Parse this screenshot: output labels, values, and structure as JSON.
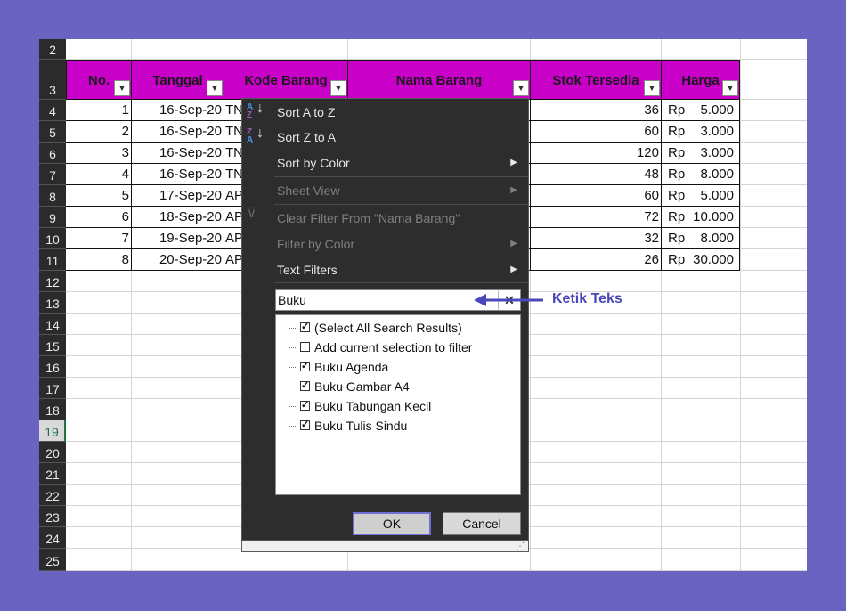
{
  "rows": [
    "2",
    "3",
    "4",
    "5",
    "6",
    "7",
    "8",
    "9",
    "10",
    "11",
    "12",
    "13",
    "14",
    "15",
    "16",
    "17",
    "18",
    "19",
    "20",
    "21",
    "22",
    "23",
    "24",
    "25"
  ],
  "headers": {
    "no": "No.",
    "tanggal": "Tanggal",
    "kode": "Kode Barang",
    "nama": "Nama Barang",
    "stok": "Stok Tersedia",
    "harga": "Harga"
  },
  "data": [
    {
      "no": "1",
      "tanggal": "16-Sep-20",
      "kode": "TN",
      "stok": "36",
      "rp": "Rp",
      "harga": "5.000"
    },
    {
      "no": "2",
      "tanggal": "16-Sep-20",
      "kode": "TN",
      "stok": "60",
      "rp": "Rp",
      "harga": "3.000"
    },
    {
      "no": "3",
      "tanggal": "16-Sep-20",
      "kode": "TN",
      "stok": "120",
      "rp": "Rp",
      "harga": "3.000"
    },
    {
      "no": "4",
      "tanggal": "16-Sep-20",
      "kode": "TN",
      "stok": "48",
      "rp": "Rp",
      "harga": "8.000"
    },
    {
      "no": "5",
      "tanggal": "17-Sep-20",
      "kode": "AP",
      "stok": "60",
      "rp": "Rp",
      "harga": "5.000"
    },
    {
      "no": "6",
      "tanggal": "18-Sep-20",
      "kode": "AP",
      "stok": "72",
      "rp": "Rp",
      "harga": "10.000"
    },
    {
      "no": "7",
      "tanggal": "19-Sep-20",
      "kode": "AP",
      "stok": "32",
      "rp": "Rp",
      "harga": "8.000"
    },
    {
      "no": "8",
      "tanggal": "20-Sep-20",
      "kode": "AP",
      "stok": "26",
      "rp": "Rp",
      "harga": "30.000"
    }
  ],
  "menu": {
    "items": [
      {
        "label": "Sort A to Z",
        "icon": "sort-a-z-icon",
        "disabled": false,
        "arrow": false
      },
      {
        "label": "Sort Z to A",
        "icon": "sort-z-a-icon",
        "disabled": false,
        "arrow": false
      },
      {
        "label": "Sort by Color",
        "icon": "",
        "disabled": false,
        "arrow": true
      },
      {
        "label": "Sheet View",
        "icon": "",
        "disabled": true,
        "arrow": true
      },
      {
        "label": "Clear Filter From \"Nama Barang\"",
        "icon": "clear-filter-icon",
        "disabled": true,
        "arrow": false
      },
      {
        "label": "Filter by Color",
        "icon": "",
        "disabled": true,
        "arrow": true
      },
      {
        "label": "Text Filters",
        "icon": "",
        "disabled": false,
        "arrow": true
      }
    ],
    "search_value": "Buku",
    "list": [
      {
        "label": "(Select All Search Results)",
        "checked": true
      },
      {
        "label": "Add current selection to filter",
        "checked": false
      },
      {
        "label": "Buku Agenda",
        "checked": true
      },
      {
        "label": "Buku Gambar A4",
        "checked": true
      },
      {
        "label": "Buku Tabungan Kecil",
        "checked": true
      },
      {
        "label": "Buku Tulis Sindu",
        "checked": true
      }
    ],
    "ok_label": "OK",
    "cancel_label": "Cancel"
  },
  "annotation": "Ketik Teks",
  "colors": {
    "header_bg": "#c800c8",
    "frame": "#6b63c2",
    "menu_bg": "#2d2d2d",
    "annotation": "#4a47b8"
  }
}
